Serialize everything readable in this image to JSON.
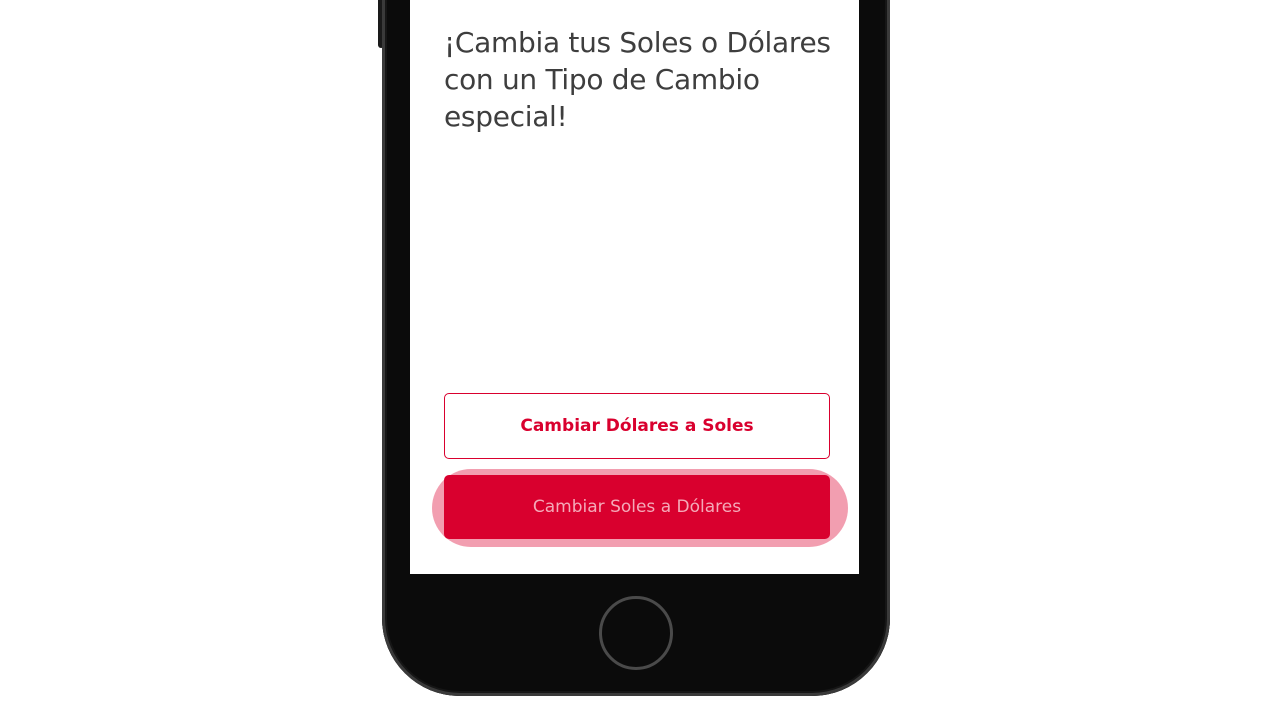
{
  "screen": {
    "headline": "¡Cambia tus Soles o Dólares con un Tipo de Cambio especial!"
  },
  "actions": {
    "dollars_to_soles_label": "Cambiar Dólares a Soles",
    "soles_to_dollars_label": "Cambiar Soles a Dólares"
  },
  "colors": {
    "brand_red": "#d9002e",
    "text_dark": "#3e3e3e",
    "phone_body": "#0b0b0b"
  },
  "icons": {
    "home": "home-button-icon"
  }
}
